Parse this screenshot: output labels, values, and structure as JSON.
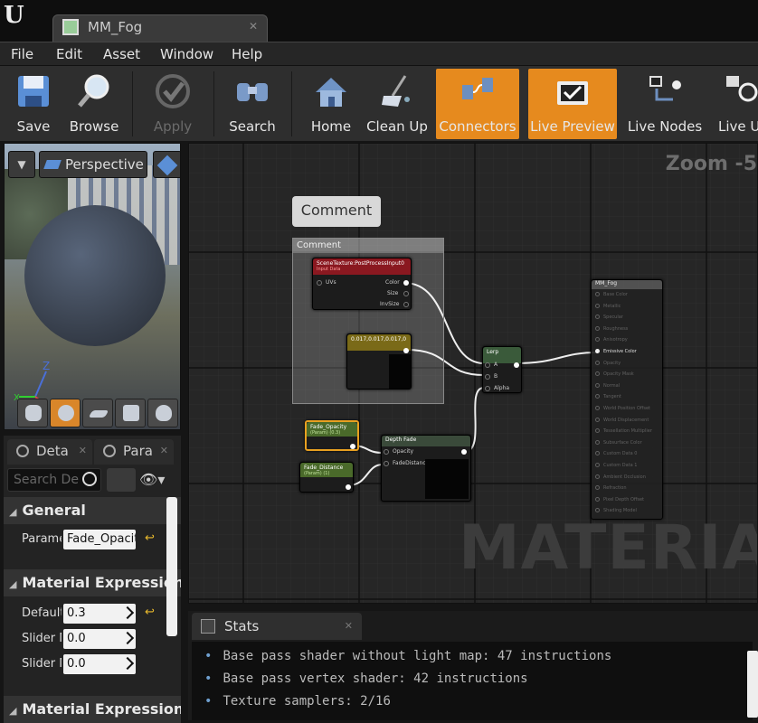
{
  "window": {
    "tab_title": "MM_Fog",
    "menu": [
      "File",
      "Edit",
      "Asset",
      "Window",
      "Help"
    ]
  },
  "toolbar": {
    "buttons": [
      {
        "label": "Save",
        "icon": "save-icon",
        "state": "normal"
      },
      {
        "label": "Browse",
        "icon": "browse-icon",
        "state": "normal"
      },
      {
        "label": "Apply",
        "icon": "apply-icon",
        "state": "disabled"
      },
      {
        "label": "Search",
        "icon": "search-icon",
        "state": "normal"
      },
      {
        "label": "Home",
        "icon": "home-icon",
        "state": "normal"
      },
      {
        "label": "Clean Up",
        "icon": "clean-up-icon",
        "state": "normal"
      },
      {
        "label": "Connectors",
        "icon": "connectors-icon",
        "state": "active"
      },
      {
        "label": "Live Preview",
        "icon": "live-preview-icon",
        "state": "active"
      },
      {
        "label": "Live Nodes",
        "icon": "live-nodes-icon",
        "state": "normal"
      },
      {
        "label": "Live U",
        "icon": "live-update-icon",
        "state": "normal"
      }
    ],
    "active_color": "#e68a1e"
  },
  "viewport": {
    "view_mode": "Perspective",
    "axis_z": "Z",
    "axis_x": "X"
  },
  "details": {
    "tabs": [
      "Deta",
      "Para"
    ],
    "search_placeholder": "Search De",
    "categories": {
      "general": "General",
      "material_expression": "Material Expression",
      "material_expression_2": "Material Expression"
    },
    "param_name_label": "Parame",
    "param_name_value": "Fade_Opacit",
    "default_label": "Default",
    "default_value": "0.3",
    "slider_min_label": "Slider M",
    "slider_min_value": "0.0",
    "slider_max_label": "Slider M",
    "slider_max_value": "0.0"
  },
  "graph": {
    "zoom_text": "Zoom -5",
    "watermark": "MATERIAL",
    "comment_bubble": "Comment",
    "comment_header": "Comment",
    "nodes": {
      "scene_texture": {
        "title": "SceneTexture:PostProcessInput0",
        "subtitle": "Input Data",
        "inputs": [
          "UVs"
        ],
        "outputs": [
          "Color",
          "Size",
          "InvSize"
        ]
      },
      "constant": {
        "title": "0.017,0.017,0.017,0"
      },
      "lerp": {
        "title": "Lerp",
        "inputs": [
          "A",
          "B",
          "Alpha"
        ]
      },
      "fade_opacity": {
        "title": "Fade_Opacity",
        "subtitle": "(Param) (0.3)"
      },
      "fade_distance": {
        "title": "Fade_Distance",
        "subtitle": "(Param) (1)"
      },
      "depth_fade": {
        "title": "Depth Fade",
        "inputs": [
          "Opacity",
          "FadeDistance"
        ]
      },
      "result": {
        "title": "MM_Fog",
        "pins": [
          "Base Color",
          "Metallic",
          "Specular",
          "Roughness",
          "Anisotropy",
          "Emissive Color",
          "Opacity",
          "Opacity Mask",
          "Normal",
          "Tangent",
          "World Position Offset",
          "World Displacement",
          "Tessellation Multiplier",
          "Subsurface Color",
          "Custom Data 0",
          "Custom Data 1",
          "Ambient Occlusion",
          "Refraction",
          "Pixel Depth Offset",
          "Shading Model"
        ]
      }
    }
  },
  "stats": {
    "tab": "Stats",
    "lines": [
      "Base pass shader without light map: 47 instructions",
      "Base pass vertex shader: 42 instructions",
      "Texture samplers: 2/16"
    ]
  }
}
